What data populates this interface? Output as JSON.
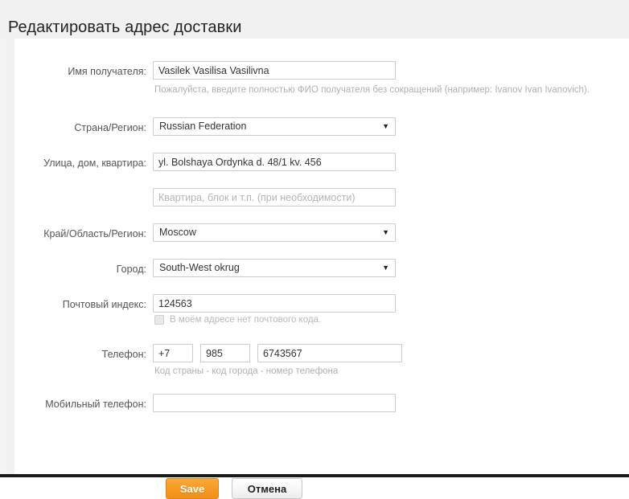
{
  "header": {
    "title": "Редактировать адрес доставки"
  },
  "form": {
    "recipient": {
      "label": "Имя получателя:",
      "value": "Vasilek Vasilisa Vasilivna",
      "hint": "Пожалуйста, введите полностью ФИО получателя без сокращений (например: Ivanov Ivan Ivanovich)."
    },
    "country": {
      "label": "Страна/Регион:",
      "value": "Russian Federation",
      "arrow": "▼"
    },
    "street": {
      "label": "Улица, дом, квартира:",
      "value": "yl. Bolshaya Ordynka d. 48/1 kv. 456"
    },
    "street2": {
      "placeholder": "Квартира, блок и т.п. (при необходимости)",
      "value": ""
    },
    "region": {
      "label": "Край/Область/Регион:",
      "value": "Moscow",
      "arrow": "▼"
    },
    "city": {
      "label": "Город:",
      "value": "South-West okrug",
      "arrow": "▼"
    },
    "postal": {
      "label": "Почтовый индекс:",
      "value": "124563",
      "checkbox_label": "В моём адресе нет почтового кода."
    },
    "phone": {
      "label": "Телефон:",
      "country_code": "+7",
      "city_code": "985",
      "number": "6743567",
      "hint": "Код страны - код города - номер телефона"
    },
    "mobile": {
      "label": "Мобильный телефон:",
      "value": ""
    }
  },
  "actions": {
    "save_label": "Save",
    "cancel_label": "Отмена"
  },
  "colors": {
    "accent": "#f79a22",
    "page_background": "#f1f1f1",
    "panel_background": "#ffffff",
    "input_border": "#cccccc",
    "label_text": "#555555",
    "hint_text": "#b0b0b0"
  }
}
